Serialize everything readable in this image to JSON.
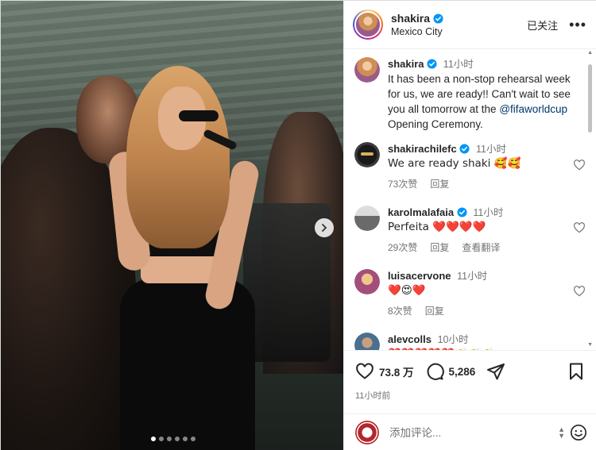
{
  "post": {
    "author": "shakira",
    "location": "Mexico City",
    "follow_label": "已关注",
    "more_label": "•••",
    "slide_count": 6,
    "active_slide": 0
  },
  "caption": {
    "username": "shakira",
    "time": "11小时",
    "text_before": "It has been a non-stop rehearsal week for us, we are ready!! Can't wait to see you all tomorrow at the",
    "mention": "@fifaworldcup",
    "text_after": "Opening Ceremony."
  },
  "comments": [
    {
      "username": "shakirachilefc",
      "verified": true,
      "time": "11小时",
      "text": "We are ready shaki 🥰🥰",
      "likes": "73次赞",
      "reply": "回复",
      "translate": ""
    },
    {
      "username": "karolmalafaia",
      "verified": true,
      "time": "11小时",
      "text": "Perfeita ❤️❤️❤️❤️",
      "likes": "29次赞",
      "reply": "回复",
      "translate": "查看翻译"
    },
    {
      "username": "luisacervone",
      "verified": false,
      "time": "11小时",
      "text": "❤️😍❤️",
      "likes": "8次赞",
      "reply": "回复",
      "translate": ""
    },
    {
      "username": "alevcolls",
      "verified": false,
      "time": "10小时",
      "text": "❤️❤️❤️❤️❤️👏👏👏",
      "likes": "",
      "reply": "",
      "translate": ""
    }
  ],
  "actions": {
    "likes_count": "73.8 万",
    "comments_count": "5,286",
    "posted_time": "11小时前"
  },
  "add_comment": {
    "placeholder": "添加评论..."
  },
  "colors": {
    "verified": "#0095f6",
    "link": "#00376b",
    "muted": "#737373"
  },
  "icons": [
    "verified-badge-icon",
    "heart-icon",
    "comment-icon",
    "share-icon",
    "bookmark-icon",
    "chevron-right-icon",
    "emoji-icon"
  ]
}
